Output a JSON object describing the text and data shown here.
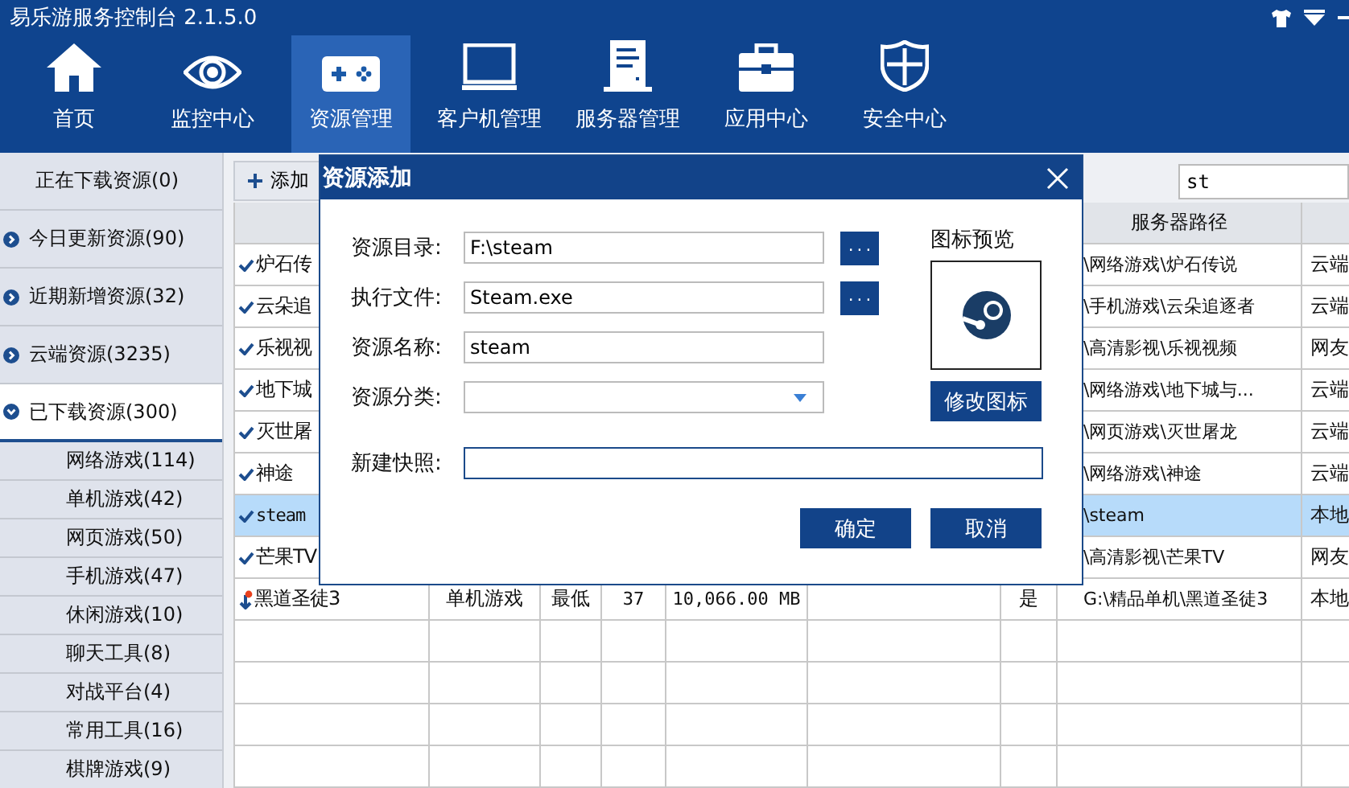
{
  "window": {
    "title": "易乐游服务控制台 2.1.5.0"
  },
  "nav": [
    {
      "label": "首页",
      "selected": false
    },
    {
      "label": "监控中心",
      "selected": false
    },
    {
      "label": "资源管理",
      "selected": true
    },
    {
      "label": "客户机管理",
      "selected": false
    },
    {
      "label": "服务器管理",
      "selected": false
    },
    {
      "label": "应用中心",
      "selected": false
    },
    {
      "label": "安全中心",
      "selected": false
    }
  ],
  "sidebar": {
    "items": [
      {
        "label": "正在下载资源(0)",
        "kind": "plain",
        "selected": false
      },
      {
        "label": "今日更新资源(90)",
        "kind": "group",
        "expanded": false,
        "selected": false
      },
      {
        "label": "近期新增资源(32)",
        "kind": "group",
        "expanded": false,
        "selected": false
      },
      {
        "label": "云端资源(3235)",
        "kind": "group",
        "expanded": false,
        "selected": false
      },
      {
        "label": "已下载资源(300)",
        "kind": "group",
        "expanded": true,
        "selected": true,
        "children": [
          {
            "label": "网络游戏(114)"
          },
          {
            "label": "单机游戏(42)"
          },
          {
            "label": "网页游戏(50)"
          },
          {
            "label": "手机游戏(47)"
          },
          {
            "label": "休闲游戏(10)"
          },
          {
            "label": "聊天工具(8)"
          },
          {
            "label": "对战平台(4)"
          },
          {
            "label": "常用工具(16)"
          },
          {
            "label": "棋牌游戏(9)"
          }
        ]
      }
    ]
  },
  "toolbar": {
    "add_button": "添加",
    "search": {
      "value": "st"
    }
  },
  "table": {
    "header": {
      "server_path": "服务器路径"
    },
    "rows": [
      {
        "kind": "done",
        "selected": false,
        "name": "炉石传",
        "server_path": "\\网络游戏\\炉石传说",
        "source": "云端"
      },
      {
        "kind": "done",
        "selected": false,
        "name": "云朵追",
        "server_path": "\\手机游戏\\云朵追逐者",
        "source": "云端"
      },
      {
        "kind": "done",
        "selected": false,
        "name": "乐视视",
        "server_path": "\\高清影视\\乐视视频",
        "source": "网友"
      },
      {
        "kind": "done",
        "selected": false,
        "name": "地下城",
        "server_path": "\\网络游戏\\地下城与...",
        "source": "云端"
      },
      {
        "kind": "done",
        "selected": false,
        "name": "灭世屠",
        "server_path": "\\网页游戏\\灭世屠龙",
        "source": "云端"
      },
      {
        "kind": "done",
        "selected": false,
        "name": "神途",
        "server_path": "\\网络游戏\\神途",
        "source": "云端"
      },
      {
        "kind": "done",
        "selected": true,
        "name": "steam",
        "server_path": "\\steam",
        "source": "本地"
      },
      {
        "kind": "done",
        "selected": false,
        "name": "芒果TV",
        "server_path": "\\高清影视\\芒果TV",
        "source": "网友"
      },
      {
        "kind": "downloading",
        "selected": false,
        "name": "黑道圣徒3",
        "column_2": "单机游戏",
        "column_3": "最低",
        "column_4": "37",
        "column_5": "10,066.00 MB",
        "column_7": "是",
        "server_path": "G:\\精品单机\\黑道圣徒3",
        "source": "本地"
      }
    ]
  },
  "dialog": {
    "title": "资源添加",
    "fields": [
      {
        "label": "资源目录:",
        "kind": "browse",
        "value": "F:\\steam",
        "button": "..."
      },
      {
        "label": "执行文件:",
        "kind": "browse",
        "value": "Steam.exe",
        "button": "..."
      },
      {
        "label": "资源名称:",
        "kind": "text",
        "value": "steam"
      },
      {
        "label": "资源分类:",
        "kind": "select"
      }
    ],
    "snapshot": {
      "label": "新建快照:"
    },
    "icon_preview": {
      "label": "图标预览",
      "button": "修改图标"
    },
    "buttons": [
      "确定",
      "取消"
    ]
  }
}
